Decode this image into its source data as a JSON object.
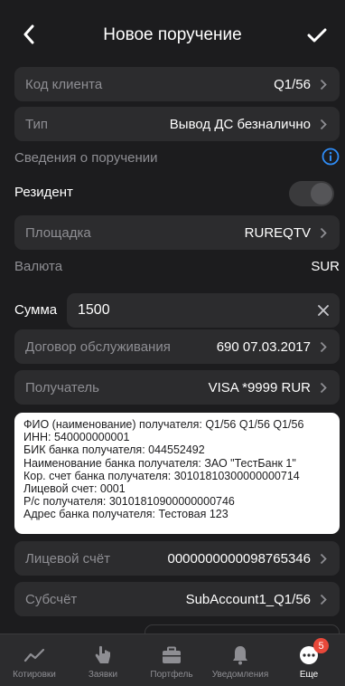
{
  "header": {
    "title": "Новое поручение"
  },
  "form": {
    "client_code": {
      "label": "Код клиента",
      "value": "Q1/56"
    },
    "type": {
      "label": "Тип",
      "value": "Вывод ДС безналично"
    },
    "section_label": "Сведения о поручении",
    "resident": {
      "label": "Резидент",
      "on": false
    },
    "platform": {
      "label": "Площадка",
      "value": "RUREQTV"
    },
    "currency": {
      "label": "Валюта",
      "value": "SUR"
    },
    "amount": {
      "label": "Сумма",
      "value": "1500"
    },
    "contract": {
      "label": "Договор обслуживания",
      "value": "690 07.03.2017"
    },
    "recipient": {
      "label": "Получатель",
      "value": "VISA *9999 RUR"
    },
    "details_lines": [
      "ФИО (наименование) получателя: Q1/56 Q1/56 Q1/56",
      "ИНН: 540000000001",
      "БИК банка получателя: 044552492",
      "Наименование банка получателя: ЗАО \"ТестБанк 1\"",
      "Кор. счет банка получателя: 30101810300000000714",
      "Лицевой счет: 0001",
      "Р/с получателя: 30101810900000000746",
      "Адрес банка получателя: Тестовая 123"
    ],
    "account": {
      "label": "Лицевой счёт",
      "value": "0000000000098765346"
    },
    "subaccount": {
      "label": "Субсчёт",
      "value": "SubAccount1_Q1/56"
    }
  },
  "tabbar": {
    "tabs": [
      {
        "label": "Котировки",
        "icon": "chart-line-icon"
      },
      {
        "label": "Заявки",
        "icon": "hand-pointer-icon"
      },
      {
        "label": "Портфель",
        "icon": "briefcase-icon"
      },
      {
        "label": "Уведомления",
        "icon": "bell-icon"
      },
      {
        "label": "Еще",
        "icon": "more-icon",
        "badge": "5"
      }
    ]
  },
  "colors": {
    "background": "#1c1c1e",
    "field": "#2c2c2e",
    "accent": "#2f8df8",
    "badge": "#e8483a"
  }
}
